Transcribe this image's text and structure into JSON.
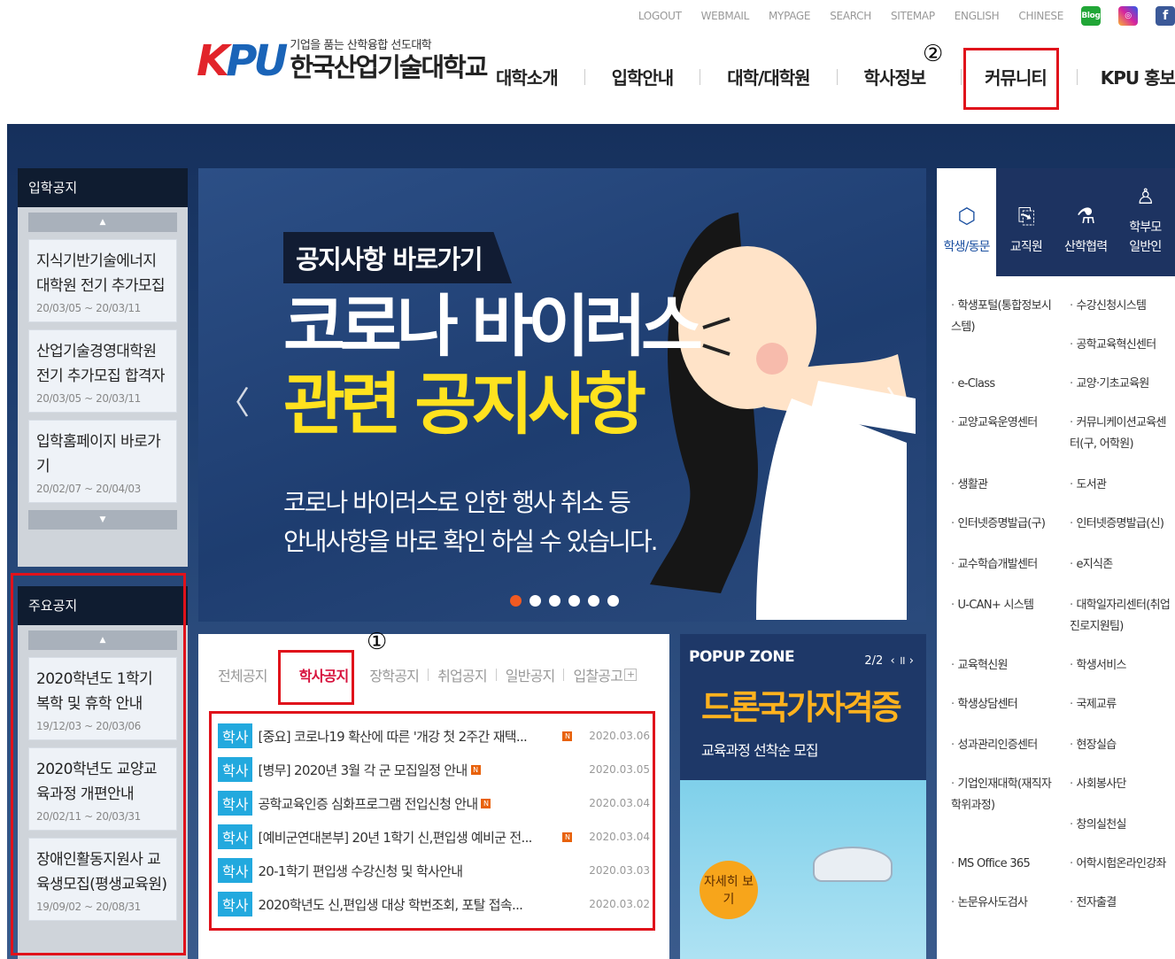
{
  "util": {
    "links": [
      "LOGOUT",
      "WEBMAIL",
      "MYPAGE",
      "SEARCH",
      "SITEMAP",
      "ENGLISH",
      "CHINESE"
    ],
    "blog": "Blog",
    "fb": "f"
  },
  "logo": {
    "mark_k": "K",
    "mark_pu": "PU",
    "tagline": "기업을 품는 산학융합 선도대학",
    "name": "한국산업기술대학교"
  },
  "gnb": [
    "대학소개",
    "입학안내",
    "대학/대학원",
    "학사정보",
    "커뮤니티",
    "KPU 홍보관"
  ],
  "annotations": {
    "one": "①",
    "two": "②"
  },
  "admission": {
    "title": "입학공지",
    "up": "▲",
    "down": "▼",
    "items": [
      {
        "title": "지식기반기술에너지대학원 전기 추가모집",
        "date": "20/03/05 ~ 20/03/11"
      },
      {
        "title": "산업기술경영대학원 전기 추가모집 합격자",
        "date": "20/03/05 ~ 20/03/11"
      },
      {
        "title": "입학홈페이지 바로가기",
        "date": "20/02/07 ~ 20/04/03"
      }
    ]
  },
  "major": {
    "title": "주요공지",
    "up": "▲",
    "items": [
      {
        "title": "2020학년도 1학기 복학 및 휴학 안내",
        "date": "19/12/03 ~ 20/03/06"
      },
      {
        "title": "2020학년도 교양교육과정 개편안내",
        "date": "20/02/11 ~ 20/03/31"
      },
      {
        "title": "장애인활동지원사 교육생모집(평생교육원)",
        "date": "19/09/02 ~ 20/08/31"
      }
    ]
  },
  "slider": {
    "badge": "공지사항 바로가기",
    "line1": "코로나 바이러스",
    "line2": "관련 공지사항",
    "sub1": "코로나 바이러스로 인한 행사 취소 등",
    "sub2": "안내사항을 바로 확인 하실 수 있습니다.",
    "prev": "〈",
    "next": "〉"
  },
  "board": {
    "tabs": [
      "전체공지",
      "학사공지",
      "장학공지",
      "취업공지",
      "일반공지",
      "입찰공고"
    ],
    "plus": "+",
    "new_mark": "N",
    "rows": [
      {
        "cat": "학사",
        "title": "[중요] 코로나19 확산에 따른 '개강 첫 2주간 재택...",
        "date": "2020.03.06",
        "new": true
      },
      {
        "cat": "학사",
        "title": "[병무] 2020년 3월 각 군 모집일정 안내",
        "date": "2020.03.05",
        "new": true
      },
      {
        "cat": "학사",
        "title": "공학교육인증 심화프로그램 전입신청 안내",
        "date": "2020.03.04",
        "new": true
      },
      {
        "cat": "학사",
        "title": "[예비군연대본부] 20년 1학기 신,편입생 예비군 전...",
        "date": "2020.03.04",
        "new": true
      },
      {
        "cat": "학사",
        "title": "20-1학기 편입생 수강신청 및 학사안내",
        "date": "2020.03.03",
        "new": false
      },
      {
        "cat": "학사",
        "title": "2020학년도 신,편입생 대상 학번조회, 포탈 접속...",
        "date": "2020.03.02",
        "new": false
      }
    ]
  },
  "popup": {
    "title": "POPUP ZONE",
    "page": "2/2",
    "controls": "‹ ॥ ›",
    "headline": "드론국가자격증",
    "sub": "교육과정 선착순 모집",
    "more": "자세히 보기"
  },
  "quick": {
    "tabs": [
      {
        "label": "학생/동문",
        "icon": "⬡"
      },
      {
        "label": "교직원",
        "icon": "⎘"
      },
      {
        "label": "산학협력",
        "icon": "⚗"
      },
      {
        "label": "학부모 일반인",
        "icon": "♙"
      }
    ],
    "left": [
      "학생포털(통합정보시스템)",
      "e-Class",
      "교양교육운영센터",
      "생활관",
      "인터넷증명발급(구)",
      "교수학습개발센터",
      "U-CAN+ 시스템",
      "교육혁신원",
      "학생상담센터",
      "성과관리인증센터",
      "기업인재대학(재직자학위과정)",
      "MS Office 365",
      "논문유사도검사"
    ],
    "right": [
      "수강신청시스템",
      "공학교육혁신센터",
      "교양·기초교육원",
      "커뮤니케이션교육센터(구, 어학원)",
      "도서관",
      "인터넷증명발급(신)",
      "e지식존",
      "대학일자리센터(취업진로지원팀)",
      "학생서비스",
      "국제교류",
      "현장실습",
      "사회봉사단",
      "창의실천실",
      "어학시험온라인강좌",
      "전자출결"
    ]
  }
}
